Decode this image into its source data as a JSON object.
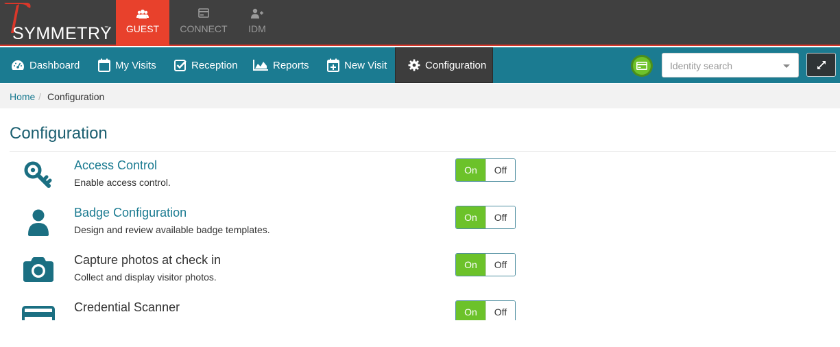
{
  "app": {
    "logo_text": "SYMMETRY",
    "logo_tm": "™",
    "tabs": [
      {
        "label": "GUEST",
        "icon": "users-icon",
        "active": true
      },
      {
        "label": "CONNECT",
        "icon": "card-icon",
        "active": false
      },
      {
        "label": "IDM",
        "icon": "user-plus-icon",
        "active": false
      }
    ]
  },
  "nav": {
    "items": [
      {
        "label": "Dashboard",
        "icon": "dashboard-icon"
      },
      {
        "label": "My Visits",
        "icon": "calendar-icon"
      },
      {
        "label": "Reception",
        "icon": "checkbox-icon"
      },
      {
        "label": "Reports",
        "icon": "area-chart-icon"
      },
      {
        "label": "New Visit",
        "icon": "calendar-plus-icon"
      },
      {
        "label": "Configuration",
        "icon": "gear-icon",
        "active": true
      }
    ],
    "search_placeholder": "Identity search"
  },
  "breadcrumb": {
    "home": "Home",
    "separator": "/",
    "current": "Configuration"
  },
  "page": {
    "title": "Configuration"
  },
  "settings": [
    {
      "title": "Access Control",
      "description": "Enable access control.",
      "icon": "key-icon",
      "on_label": "On",
      "off_label": "Off",
      "state": "on"
    },
    {
      "title": "Badge Configuration",
      "description": "Design and review available badge templates.",
      "icon": "user-icon",
      "on_label": "On",
      "off_label": "Off",
      "state": "on"
    },
    {
      "title": "Capture photos at check in",
      "description": "Collect and display visitor photos.",
      "icon": "camera-icon",
      "on_label": "On",
      "off_label": "Off",
      "state": "on"
    },
    {
      "title": "Credential Scanner",
      "description": "",
      "icon": "credit-card-icon",
      "on_label": "On",
      "off_label": "Off",
      "state": "on"
    }
  ],
  "colors": {
    "brand_red": "#e8412c",
    "nav_teal": "#1b7b91",
    "toggle_green": "#6cc22a",
    "topbar_gray": "#404040"
  }
}
